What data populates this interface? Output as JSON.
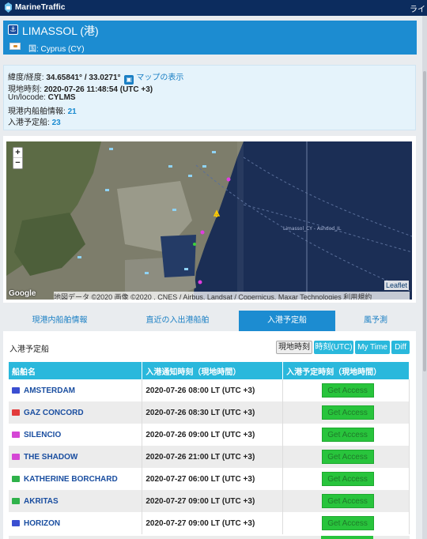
{
  "topbar": {
    "brand": "MarineTraffic",
    "right_text": "ライ"
  },
  "port": {
    "title": "LIMASSOL (港)",
    "country": "国: Cyprus (CY)"
  },
  "info": {
    "coords_label": "緯度/経度:",
    "coords_value": "34.65841° / 33.0271°",
    "map_link": "マップの表示",
    "local_time_label": "現地時刻:",
    "local_time_value": "2020-07-26 11:48:54 (UTC +3)",
    "unlocode_label": "Un/locode:",
    "unlocode_value": "CYLMS",
    "in_port_label": "現港内船舶情報:",
    "in_port_value": "21",
    "expected_label": "入港予定船:",
    "expected_value": "23"
  },
  "map": {
    "zoom_in": "+",
    "zoom_out": "−",
    "leaflet": "Leaflet",
    "google": "Google",
    "attribution": "地図データ ©2020 画像 ©2020 , CNES / Airbus, Landsat / Copernicus, Maxar Technologies   利用規約",
    "route_label": "Limassol_CY - Ashdod_IL"
  },
  "tabs": [
    "現港内船舶情報",
    "直近の入出港船舶",
    "入港予定船",
    "風予測"
  ],
  "panel": {
    "label": "入港予定船",
    "buttons": [
      "現地時刻",
      "時刻(UTC)",
      "My Time",
      "Diff"
    ]
  },
  "table": {
    "columns": [
      "船舶名",
      "入港通知時刻（現地時間）",
      "入港予定時刻（現地時間）"
    ],
    "rows": [
      {
        "name": "AMSTERDAM",
        "time": "2020-07-26 08:00 LT (UTC +3)",
        "action": "Get Access",
        "icon_color": "#3b4fd1"
      },
      {
        "name": "GAZ CONCORD",
        "time": "2020-07-26 08:30 LT (UTC +3)",
        "action": "Get Access",
        "icon_color": "#e23b3b"
      },
      {
        "name": "SILENCIO",
        "time": "2020-07-26 09:00 LT (UTC +3)",
        "action": "Get Access",
        "icon_color": "#d547d5"
      },
      {
        "name": "THE SHADOW",
        "time": "2020-07-26 21:00 LT (UTC +3)",
        "action": "Get Access",
        "icon_color": "#d547d5"
      },
      {
        "name": "KATHERINE BORCHARD",
        "time": "2020-07-27 06:00 LT (UTC +3)",
        "action": "Get Access",
        "icon_color": "#2fb24a"
      },
      {
        "name": "AKRITAS",
        "time": "2020-07-27 09:00 LT (UTC +3)",
        "action": "Get Access",
        "icon_color": "#2fb24a"
      },
      {
        "name": "HORIZON",
        "time": "2020-07-27 09:00 LT (UTC +3)",
        "action": "Get Access",
        "icon_color": "#3b4fd1"
      }
    ]
  }
}
